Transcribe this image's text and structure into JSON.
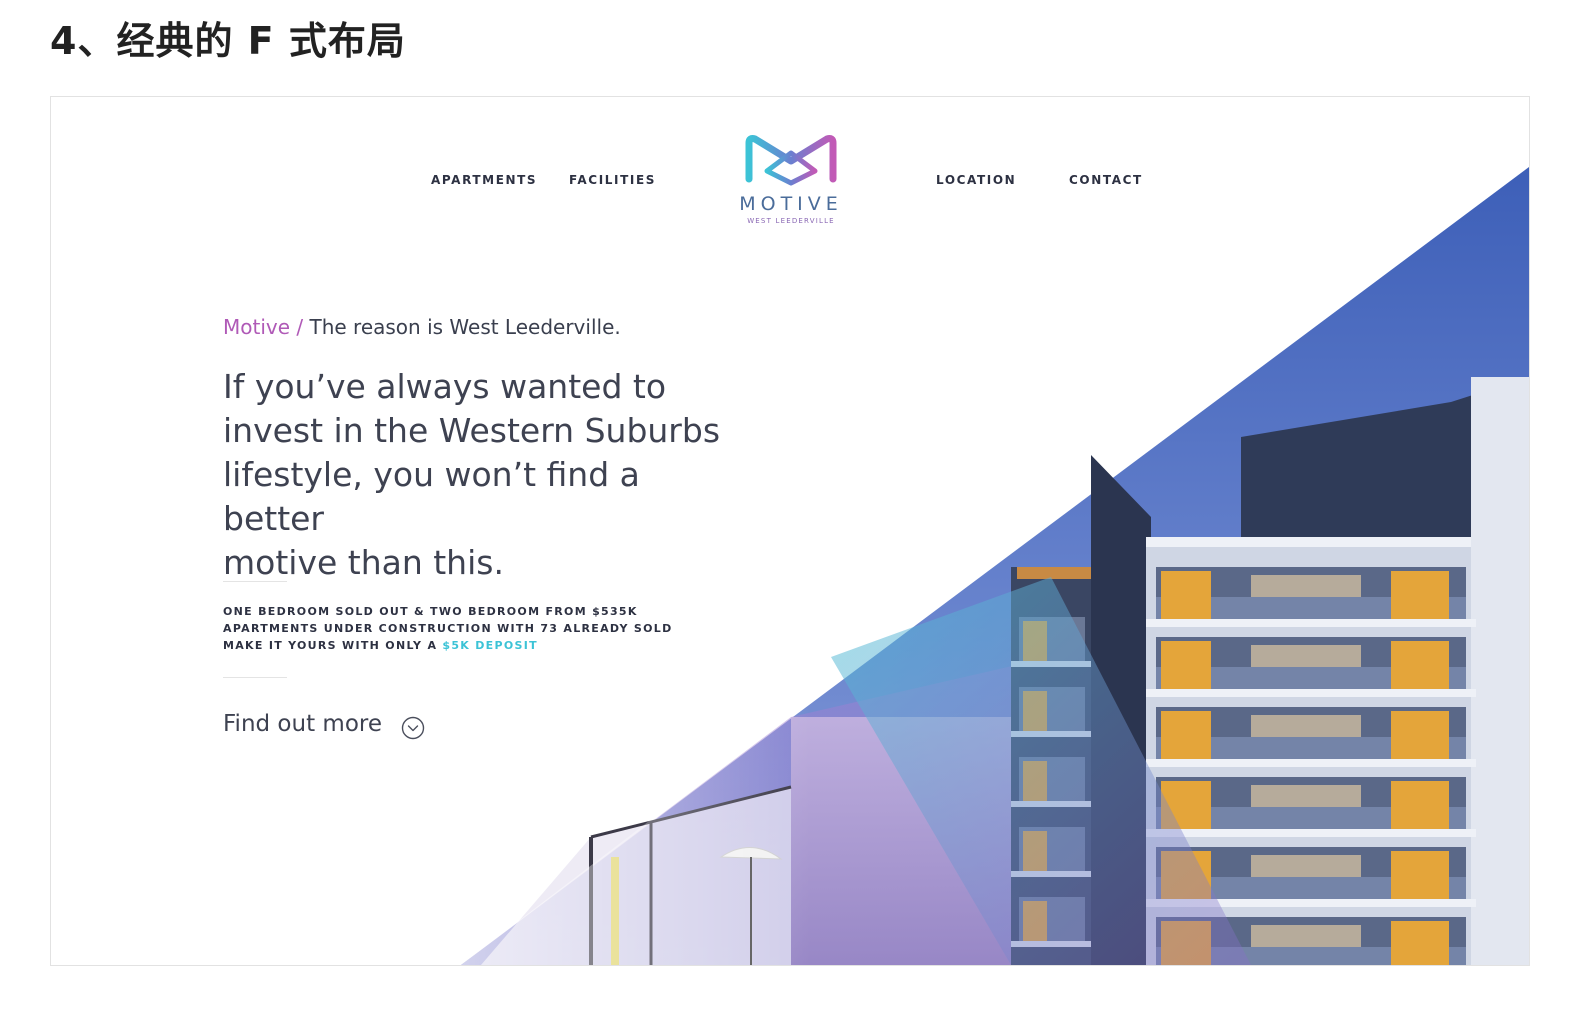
{
  "article": {
    "heading": "4、经典的 F 式布局"
  },
  "site": {
    "nav_left": [
      {
        "label": "APARTMENTS"
      },
      {
        "label": "FACILITIES"
      }
    ],
    "nav_right": [
      {
        "label": "LOCATION"
      },
      {
        "label": "CONTACT"
      }
    ],
    "logo": {
      "name": "MOTIVE",
      "subtitle": "WEST LEEDERVILLE"
    },
    "breadcrumb": {
      "brand": "Motive",
      "separator": " / ",
      "tagline": "The reason is West Leederville."
    },
    "hero": {
      "lines": [
        "If you’ve always wanted to",
        "invest in the Western Suburbs",
        "lifestyle, you won’t find a better",
        "motive than this."
      ]
    },
    "facts": {
      "line1": "ONE BEDROOM SOLD OUT & TWO BEDROOM FROM $535K",
      "line2": "APARTMENTS UNDER CONSTRUCTION WITH 73 ALREADY SOLD",
      "line3_prefix": "MAKE IT YOURS WITH ONLY A ",
      "line3_link": "$5K DEPOSIT"
    },
    "cta": {
      "label": "Find out more",
      "icon": "chevron-down-circle-icon"
    },
    "colors": {
      "brand_purple": "#b05ab7",
      "accent_teal": "#3cc3d6",
      "text_dark": "#2d3142",
      "sky_blue": "#4f6fbf"
    }
  }
}
